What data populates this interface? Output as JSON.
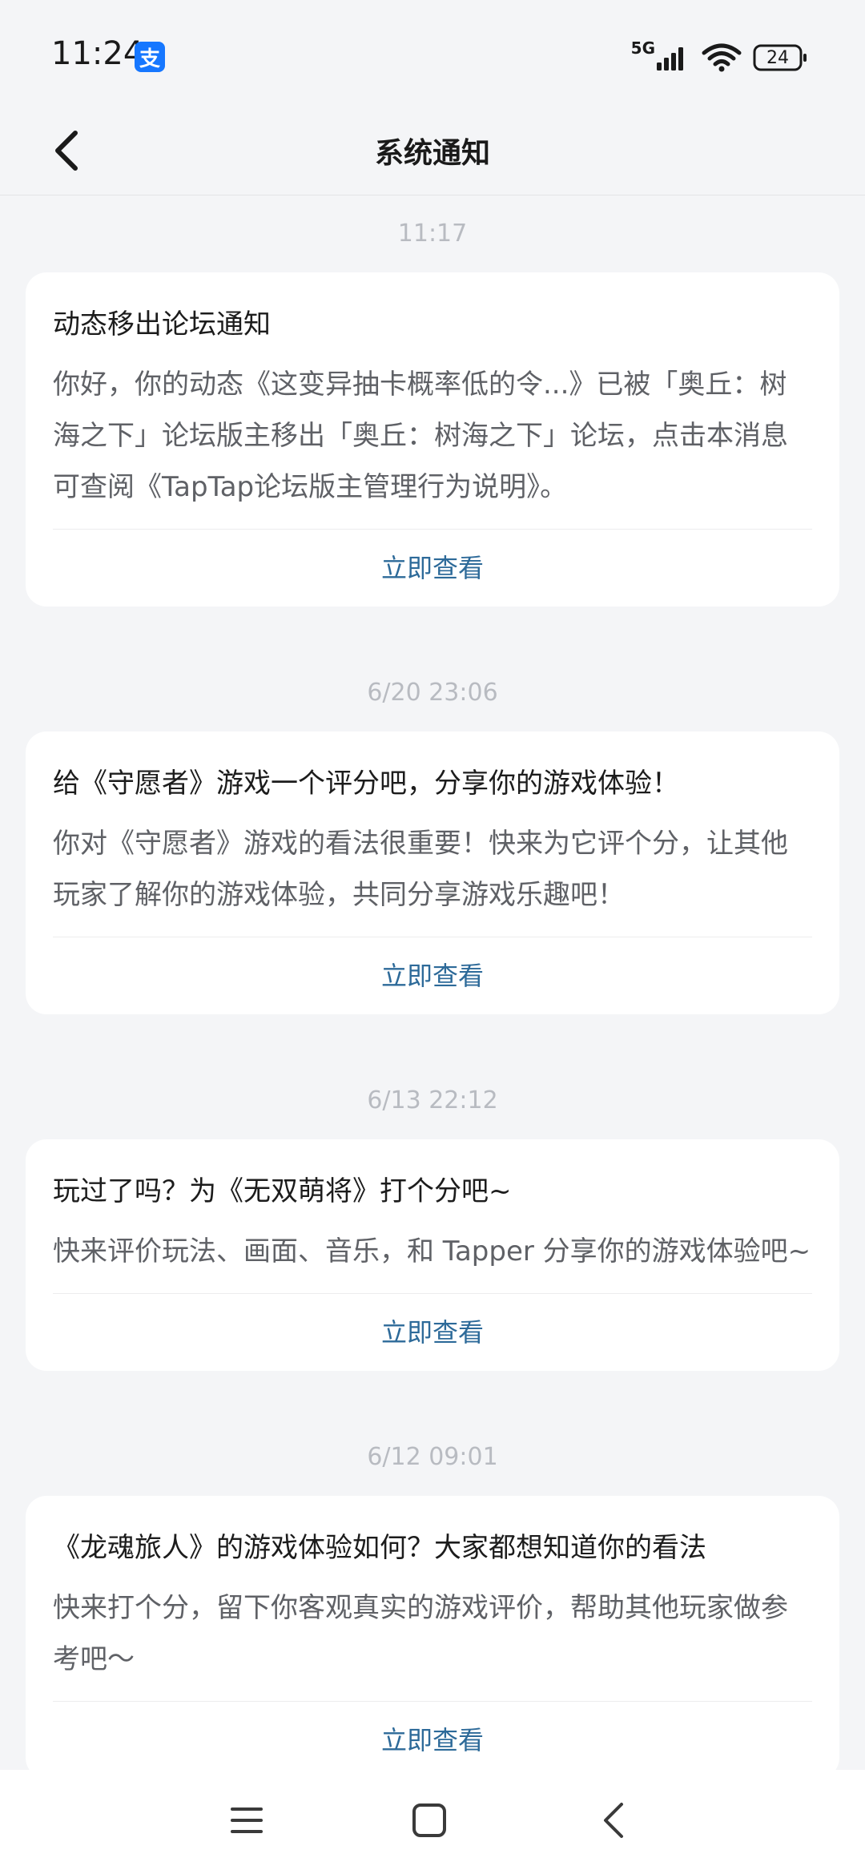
{
  "status_bar": {
    "time": "11:24",
    "app_badge": "支",
    "network": "5G",
    "battery": "24"
  },
  "header": {
    "title": "系统通知"
  },
  "notifications": [
    {
      "timestamp": "11:17",
      "title": "动态移出论坛通知",
      "body": "你好，你的动态《这变异抽卡概率低的令...》已被「奥丘：树海之下」论坛版主移出「奥丘：树海之下」论坛，点击本消息可查阅《TapTap论坛版主管理行为说明》。",
      "action": "立即查看"
    },
    {
      "timestamp": "6/20  23:06",
      "title": "给《守愿者》游戏一个评分吧，分享你的游戏体验！",
      "body": "你对《守愿者》游戏的看法很重要！快来为它评个分，让其他玩家了解你的游戏体验，共同分享游戏乐趣吧！",
      "action": "立即查看"
    },
    {
      "timestamp": "6/13  22:12",
      "title": "玩过了吗？为《无双萌将》打个分吧~",
      "body": "快来评价玩法、画面、音乐，和 Tapper 分享你的游戏体验吧~",
      "action": "立即查看"
    },
    {
      "timestamp": "6/12  09:01",
      "title": "《龙魂旅人》的游戏体验如何？大家都想知道你的看法",
      "body": "快来打个分，留下你客观真实的游戏评价，帮助其他玩家做参考吧～",
      "action": "立即查看"
    }
  ],
  "colors": {
    "background": "#f4f5f7",
    "card": "#ffffff",
    "action_link": "#2d6a99",
    "timestamp": "#b8bbc1",
    "alipay_blue": "#1677ff"
  },
  "icons": {
    "back": "chevron-left-icon",
    "nav_menu": "menu-icon",
    "nav_home": "square-home-icon",
    "nav_back": "chevron-back-icon"
  }
}
